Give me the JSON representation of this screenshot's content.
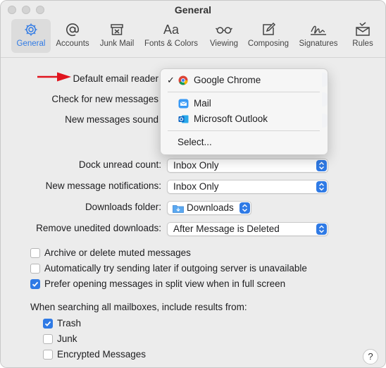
{
  "window": {
    "title": "General"
  },
  "toolbar": {
    "items": [
      {
        "label": "General",
        "icon": "gear-icon",
        "selected": true
      },
      {
        "label": "Accounts",
        "icon": "at-sign-icon"
      },
      {
        "label": "Junk Mail",
        "icon": "junk-bin-icon"
      },
      {
        "label": "Fonts & Colors",
        "icon": "fonts-icon",
        "glyph": "Aa"
      },
      {
        "label": "Viewing",
        "icon": "glasses-icon"
      },
      {
        "label": "Composing",
        "icon": "compose-icon"
      },
      {
        "label": "Signatures",
        "icon": "signature-icon"
      },
      {
        "label": "Rules",
        "icon": "rules-icon"
      }
    ]
  },
  "settings": {
    "default_email_reader": {
      "label": "Default email reader"
    },
    "check_new_messages": {
      "label": "Check for new messages"
    },
    "new_messages_sound": {
      "label": "New messages sound"
    },
    "dock_unread_count": {
      "label": "Dock unread count:",
      "value": "Inbox Only"
    },
    "new_message_notifications": {
      "label": "New message notifications:",
      "value": "Inbox Only"
    },
    "downloads_folder": {
      "label": "Downloads folder:",
      "value": "Downloads"
    },
    "remove_unedited_downloads": {
      "label": "Remove unedited downloads:",
      "value": "After Message is Deleted"
    }
  },
  "checkboxes": [
    {
      "label": "Archive or delete muted messages",
      "checked": false
    },
    {
      "label": "Automatically try sending later if outgoing server is unavailable",
      "checked": false
    },
    {
      "label": "Prefer opening messages in split view when in full screen",
      "checked": true
    }
  ],
  "search": {
    "heading": "When searching all mailboxes, include results from:",
    "options": [
      {
        "label": "Trash",
        "checked": true
      },
      {
        "label": "Junk",
        "checked": false
      },
      {
        "label": "Encrypted Messages",
        "checked": false
      }
    ]
  },
  "dropdown_menu": {
    "checkmark": "✓",
    "items": [
      {
        "label": "Google Chrome",
        "icon": "chrome-icon",
        "checked": true
      },
      {
        "label": "Mail",
        "icon": "mail-app-icon"
      },
      {
        "label": "Microsoft Outlook",
        "icon": "outlook-icon"
      },
      {
        "label": "Select..."
      }
    ]
  },
  "help": {
    "label": "?"
  },
  "colors": {
    "accent": "#2f7ae5",
    "annotation_arrow": "#e0141e"
  }
}
